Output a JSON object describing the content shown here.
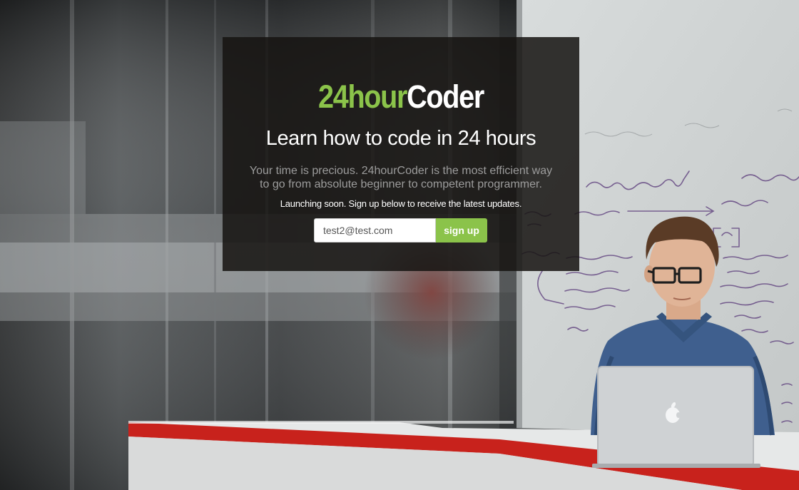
{
  "hero": {
    "logo_part1": "24hour",
    "logo_part2": "Coder",
    "headline": "Learn how to code in 24 hours",
    "description": "Your time is precious. 24hourCoder is the most efficient way to go from absolute beginner to competent programmer.",
    "launch_note": "Launching soon. Sign up below to receive the latest updates."
  },
  "signup_form": {
    "email_value": "test2@test.com",
    "button_label": "sign up"
  },
  "colors": {
    "accent_green": "#8bc34a",
    "panel_bg": "#161412",
    "marker_purple": "#5a3a7a",
    "desk_red": "#c8221c"
  }
}
